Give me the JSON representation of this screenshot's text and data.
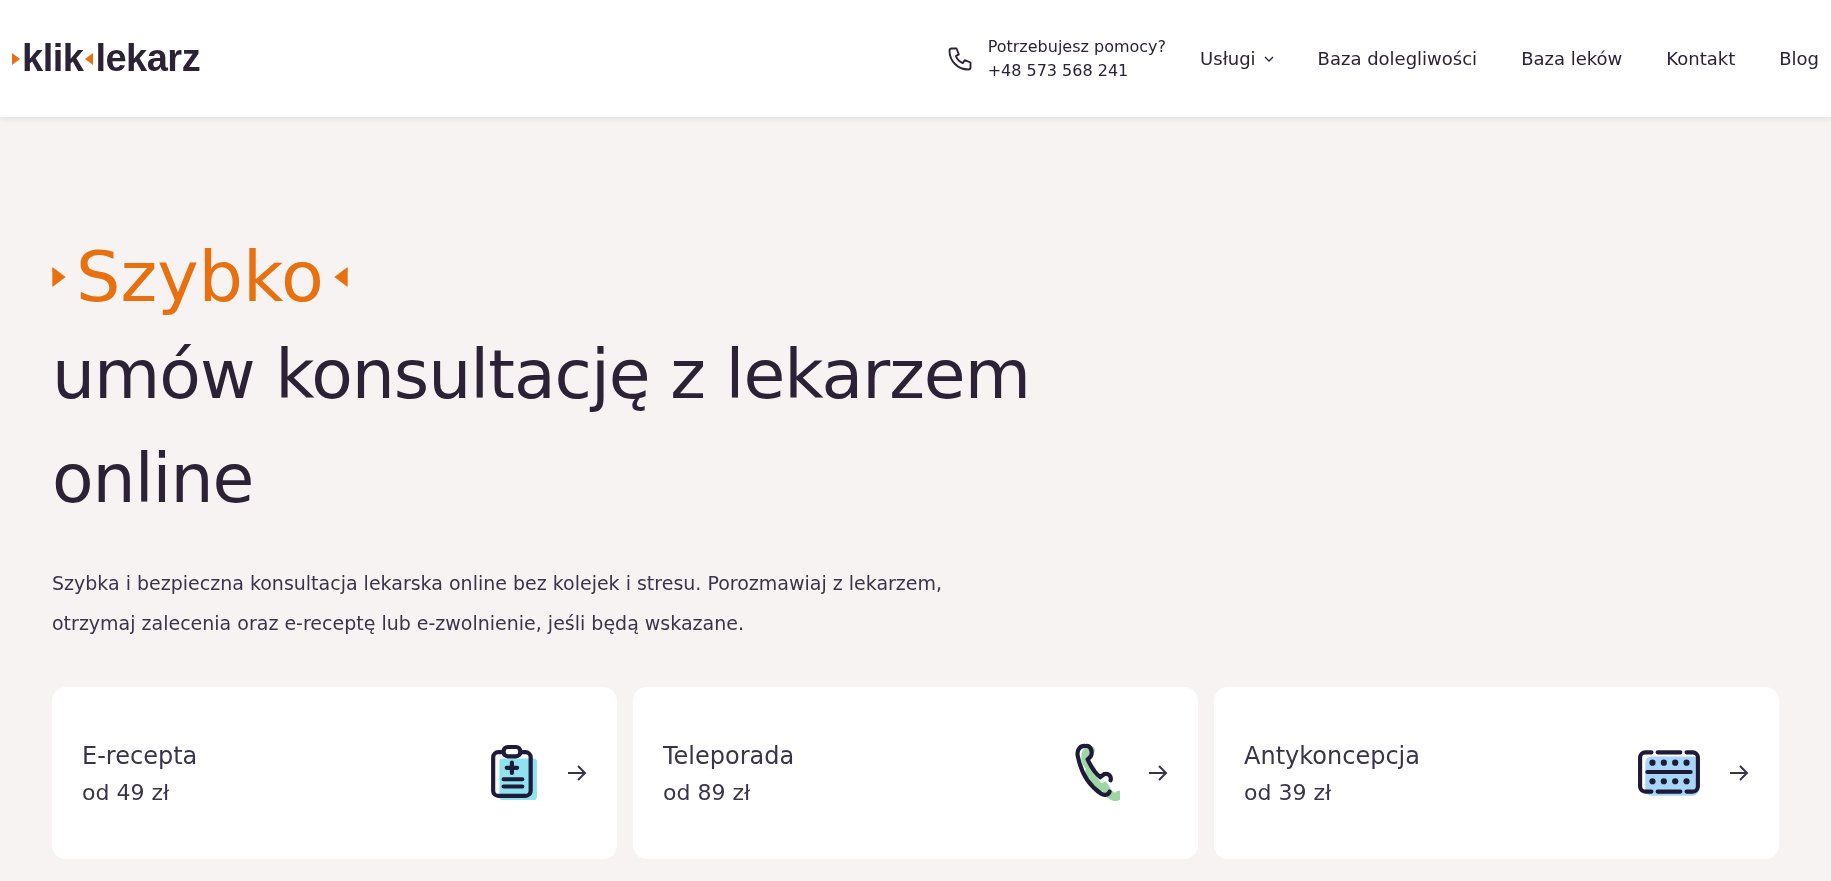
{
  "header": {
    "logo": [
      "klik",
      "lekarz"
    ],
    "help": {
      "label": "Potrzebujesz pomocy?",
      "phone": "+48 573 568 241"
    },
    "nav": [
      {
        "label": "Usługi",
        "dropdown": true
      },
      {
        "label": "Baza dolegliwości",
        "dropdown": false
      },
      {
        "label": "Baza leków",
        "dropdown": false
      },
      {
        "label": "Kontakt",
        "dropdown": false
      },
      {
        "label": "Blog",
        "dropdown": false
      }
    ]
  },
  "hero": {
    "highlight": "Szybko",
    "title": "umów konsultację z lekarzem online",
    "description": "Szybka i bezpieczna konsultacja lekarska online bez kolejek i stresu. Porozmawiaj z lekarzem, otrzymaj zalecenia oraz e-receptę lub e-zwolnienie, jeśli będą wskazane."
  },
  "services": [
    {
      "name": "E-recepta",
      "price": "od 49 zł",
      "kind": "clipboard"
    },
    {
      "name": "Teleporada",
      "price": "od 89 zł",
      "kind": "phone"
    },
    {
      "name": "Antykoncepcja",
      "price": "od 39 zł",
      "kind": "pills"
    }
  ]
}
